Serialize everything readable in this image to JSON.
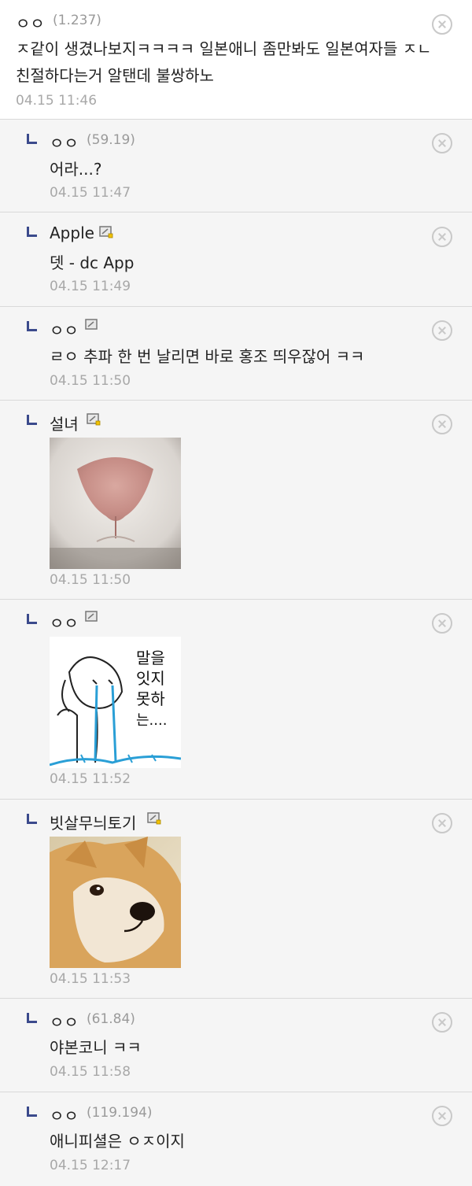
{
  "comments": [
    {
      "author": "ㅇㅇ",
      "ip": "(1.237)",
      "body_line1": "ㅈ같이 생겼나보지ㅋㅋㅋㅋ 일본애니 좀만봐도 일본여자들 ㅈㄴ",
      "body_line2": "친절하다는거 알탠데 불쌍하노",
      "date": "04.15 11:46"
    },
    {
      "author": "ㅇㅇ",
      "ip": "(59.19)",
      "body": "어라...?",
      "date": "04.15 11:47"
    },
    {
      "author": "Apple",
      "body": "뎃 - dc App",
      "date": "04.15 11:49"
    },
    {
      "author": "ㅇㅇ",
      "body": "ㄹㅇ 추파 한 번 날리면 바로 홍조 띄우잖어 ㅋㅋ",
      "date": "04.15 11:50"
    },
    {
      "author": "설녀",
      "date": "04.15 11:50",
      "image": "nose-closeup-dccon"
    },
    {
      "author": "ㅇㅇ",
      "date": "04.15 11:52",
      "image": "crying-doodle-dccon",
      "image_text": [
        "말을",
        "잇지",
        "못하",
        "는...."
      ]
    },
    {
      "author": "빗살무늬토기",
      "date": "04.15 11:53",
      "image": "doge-shiba-dccon"
    },
    {
      "author": "ㅇㅇ",
      "ip": "(61.84)",
      "body": "야본코니 ㅋㅋ",
      "date": "04.15 11:58"
    },
    {
      "author": "ㅇㅇ",
      "ip": "(119.194)",
      "body": "애니피셜은 ㅇㅈ이지",
      "date": "04.15 12:17"
    }
  ],
  "icons": {
    "reply": "reply-arrow-icon",
    "fixed_nick": "fixed-nick-icon",
    "delete": "delete-circle-x-icon"
  },
  "colors": {
    "reply_bg": "#f5f5f5",
    "reply_mark": "#3b4a8c",
    "meta_text": "#a8a8a8"
  }
}
